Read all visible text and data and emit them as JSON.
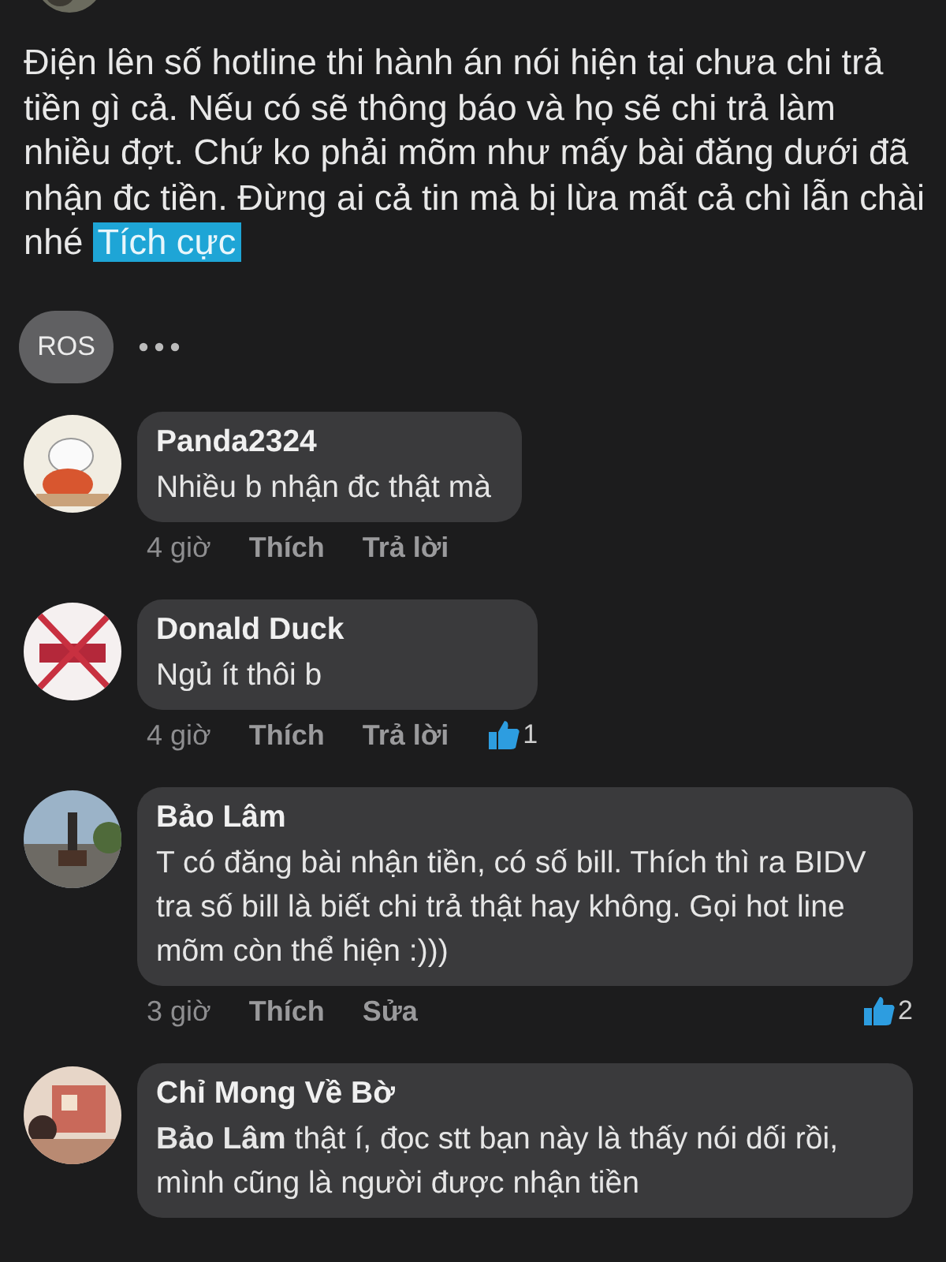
{
  "post": {
    "text": "Điện lên số hotline thi hành án nói hiện tại chưa chi trả tiền gì cả. Nếu có sẽ thông báo và họ sẽ chi trả làm nhiều đợt. Chứ ko phải mõm như mấy bài đăng dưới đã nhận đc tiền. Đừng ai cả tin mà bị lừa mất cả chì lẫn chài nhé",
    "tag": "Tích cực"
  },
  "reactor_bar": {
    "chip": "ROS"
  },
  "comments": [
    {
      "name": "Panda2324",
      "text": "Nhiều b nhận đc thật mà",
      "time": "4 giờ",
      "actions": [
        "Thích",
        "Trả lời"
      ]
    },
    {
      "name": "Donald Duck",
      "text": "Ngủ ít thôi b",
      "time": "4 giờ",
      "actions": [
        "Thích",
        "Trả lời"
      ],
      "likes": "1"
    },
    {
      "name": "Bảo Lâm",
      "text": "T có đăng bài nhận tiền, có số bill. Thích thì ra BIDV tra số bill là biết chi trả thật hay không. Gọi hot line mõm còn thể hiện :)))",
      "time": "3 giờ",
      "actions": [
        "Thích",
        "Sửa"
      ],
      "likes": "2"
    },
    {
      "name": "Chỉ Mong Về Bờ",
      "text": "**Bảo Lâm**  thật í, đọc stt bạn này là thấy nói dối rồi, mình cũng là người được nhận tiền"
    }
  ]
}
